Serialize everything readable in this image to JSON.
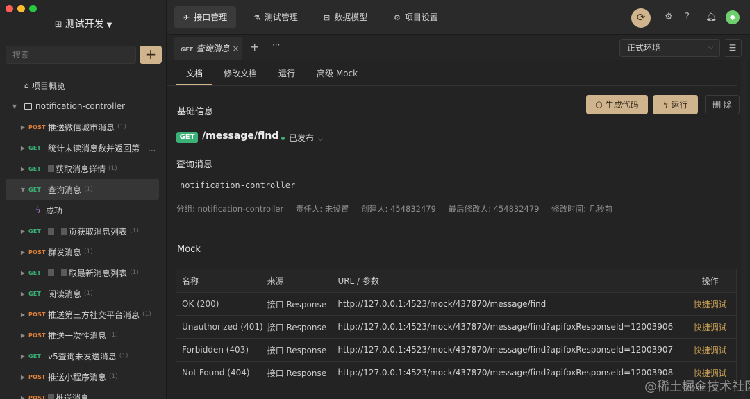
{
  "window": {
    "traffic_colors": [
      "#ff5f57",
      "#febc2e",
      "#28c840"
    ]
  },
  "sidebar": {
    "project_title": "测试开发",
    "search_placeholder": "搜索",
    "add_label": "+",
    "overview": "项目概览",
    "folder": "notification-controller",
    "items": [
      {
        "method": "POST",
        "label": "推送微信城市消息",
        "count": "(1)"
      },
      {
        "method": "GET",
        "label": "统计未读消息数并返回第一...",
        "count": ""
      },
      {
        "method": "GET",
        "label": "获取消息详情",
        "count": "(1)",
        "blurred": 1
      },
      {
        "method": "GET",
        "label": "查询消息",
        "count": "(1)",
        "selected": true
      },
      {
        "method": "GET",
        "label": "页获取消息列表",
        "count": "(1)",
        "blurred": 2
      },
      {
        "method": "POST",
        "label": "群发消息",
        "count": "(1)"
      },
      {
        "method": "GET",
        "label": "取最新消息列表",
        "count": "(1)",
        "blurred": 2
      },
      {
        "method": "GET",
        "label": "阅读消息",
        "count": "(1)"
      },
      {
        "method": "POST",
        "label": "推送第三方社交平台消息",
        "count": "(1)"
      },
      {
        "method": "POST",
        "label": "推送一次性消息",
        "count": "(1)"
      },
      {
        "method": "GET",
        "label": "v5查询未发送消息",
        "count": "(1)"
      },
      {
        "method": "POST",
        "label": "推送小程序消息",
        "count": "(1)"
      },
      {
        "method": "POST",
        "label": "推送消息",
        "count": "",
        "blurred": 1
      }
    ],
    "child_item": "成功"
  },
  "topbar": {
    "tabs": [
      "接口管理",
      "测试管理",
      "数据模型",
      "项目设置"
    ],
    "avatar_letter": "◆"
  },
  "tabstrip": {
    "doc_tab_method": "GET",
    "doc_tab_label": "查询消息",
    "close": "×",
    "add": "+",
    "more": "···",
    "environment": "正式环境"
  },
  "main": {
    "subtabs": [
      "文档",
      "修改文档",
      "运行",
      "高级 Mock"
    ],
    "basic_info_title": "基础信息",
    "buttons": {
      "generate_code": "生成代码",
      "run": "运行",
      "delete": "删 除"
    },
    "method": "GET",
    "path": "/message/find",
    "status": "已发布",
    "api_name": "查询消息",
    "controller": "notification-controller",
    "meta": {
      "group": "分组: notification-controller",
      "owner": "责任人: 未设置",
      "creator": "创建人: 454832479",
      "modifier": "最后修改人: 454832479",
      "modified_time": "修改时间: 几秒前"
    },
    "mock_title": "Mock",
    "mock_headers": [
      "名称",
      "来源",
      "URL / 参数",
      "操作"
    ],
    "mock_rows": [
      {
        "name": "OK (200)",
        "source": "接口 Response",
        "url": "http://127.0.0.1:4523/mock/437870/message/find",
        "action": "快捷调试"
      },
      {
        "name": "Unauthorized (401)",
        "source": "接口 Response",
        "url": "http://127.0.0.1:4523/mock/437870/message/find?apifoxResponseId=12003906",
        "action": "快捷调试"
      },
      {
        "name": "Forbidden (403)",
        "source": "接口 Response",
        "url": "http://127.0.0.1:4523/mock/437870/message/find?apifoxResponseId=12003907",
        "action": "快捷调试"
      },
      {
        "name": "Not Found (404)",
        "source": "接口 Response",
        "url": "http://127.0.0.1:4523/mock/437870/message/find?apifoxResponseId=12003908",
        "action": "快捷调试"
      }
    ]
  },
  "watermark": {
    "text": "@稀土掘金技术社区",
    "sub": "Cookie"
  },
  "colors": {
    "accent": "#cfb48e",
    "get": "#3bb077",
    "post": "#e2823a",
    "action": "#cfa457"
  }
}
